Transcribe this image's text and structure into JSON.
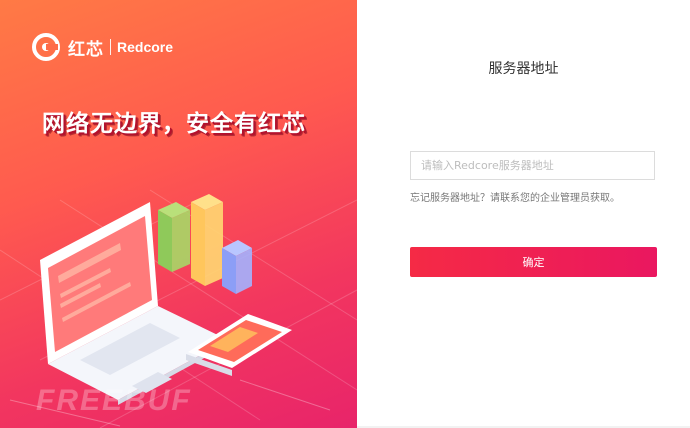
{
  "brand": {
    "name_cn": "红芯",
    "name_en": "Redcore",
    "logo_icon": "redcore-ring-icon"
  },
  "promo": {
    "slogan": "网络无边界，安全有红芯",
    "watermark": "FREEBUF"
  },
  "form": {
    "title": "服务器地址",
    "server_input": {
      "placeholder": "请输入Redcore服务器地址",
      "value": ""
    },
    "hint": "忘记服务器地址？请联系您的企业管理员获取。",
    "confirm_label": "确定"
  },
  "colors": {
    "gradient_start": "#ff7a45",
    "gradient_end": "#e8246a",
    "button": "#f0204f",
    "text": "#333333",
    "hint": "#777777"
  }
}
